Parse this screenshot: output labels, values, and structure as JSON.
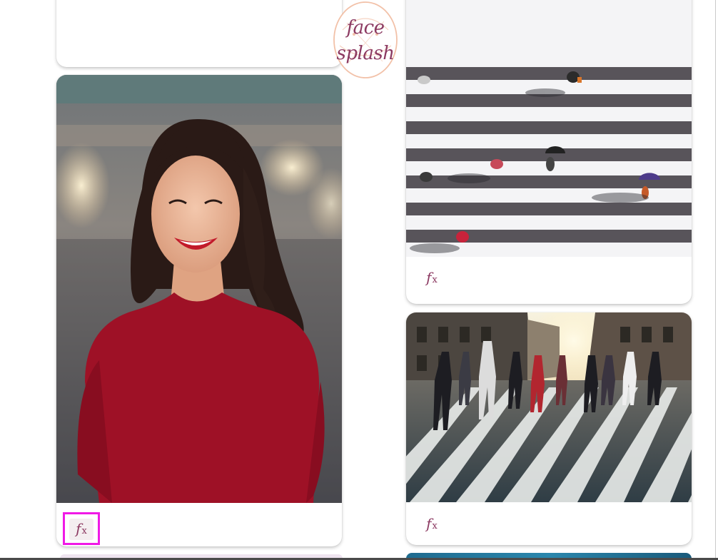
{
  "logo": {
    "line1": "face",
    "line2": "splash"
  },
  "cards": [
    {
      "id": "portrait",
      "alt": "Smiling woman in red top",
      "action_label": "f",
      "action_sub": "x"
    },
    {
      "id": "crosswalk-top",
      "alt": "Aerial view of people on crosswalk",
      "action_label": "f",
      "action_sub": "x"
    },
    {
      "id": "crosswalk-street",
      "alt": "People crossing a city street at sunset",
      "action_label": "f",
      "action_sub": "x"
    }
  ],
  "colors": {
    "brand": "#8c3a62",
    "highlight": "#f019e6",
    "logo_ring": "#f2c1a8"
  }
}
